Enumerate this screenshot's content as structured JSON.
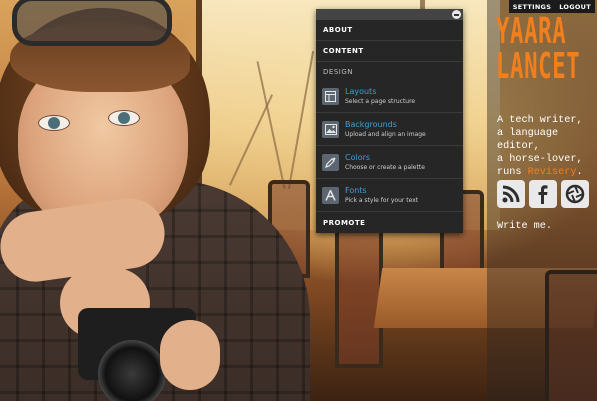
{
  "topnav": {
    "settings_label": "SETTINGS",
    "logout_label": "LOGOUT"
  },
  "site": {
    "title_line1": "YAARA",
    "title_line2": "LANCET",
    "accent_color": "#f07f1e",
    "tagline": {
      "line1": "A tech writer,",
      "line2": "a language editor,",
      "line3": "a horse-lover,",
      "line4_prefix": "runs ",
      "line4_link": "Revisery",
      "line4_suffix": "."
    },
    "social": [
      {
        "icon": "rss-icon"
      },
      {
        "icon": "facebook-icon"
      },
      {
        "icon": "camera-shutter-icon"
      }
    ],
    "write_me_label": "Write me."
  },
  "menu": {
    "about_label": "ABOUT",
    "content_label": "CONTENT",
    "design_heading": "DESIGN",
    "items": [
      {
        "title": "Layouts",
        "subtitle": "Select a page structure",
        "icon": "layout-icon"
      },
      {
        "title": "Backgrounds",
        "subtitle": "Upload and align an image",
        "icon": "image-icon"
      },
      {
        "title": "Colors",
        "subtitle": "Choose or create a palette",
        "icon": "eyedropper-icon"
      },
      {
        "title": "Fonts",
        "subtitle": "Pick a style for your text",
        "icon": "font-icon"
      }
    ],
    "promote_label": "PROMOTE",
    "link_color": "#3f9fd6"
  }
}
